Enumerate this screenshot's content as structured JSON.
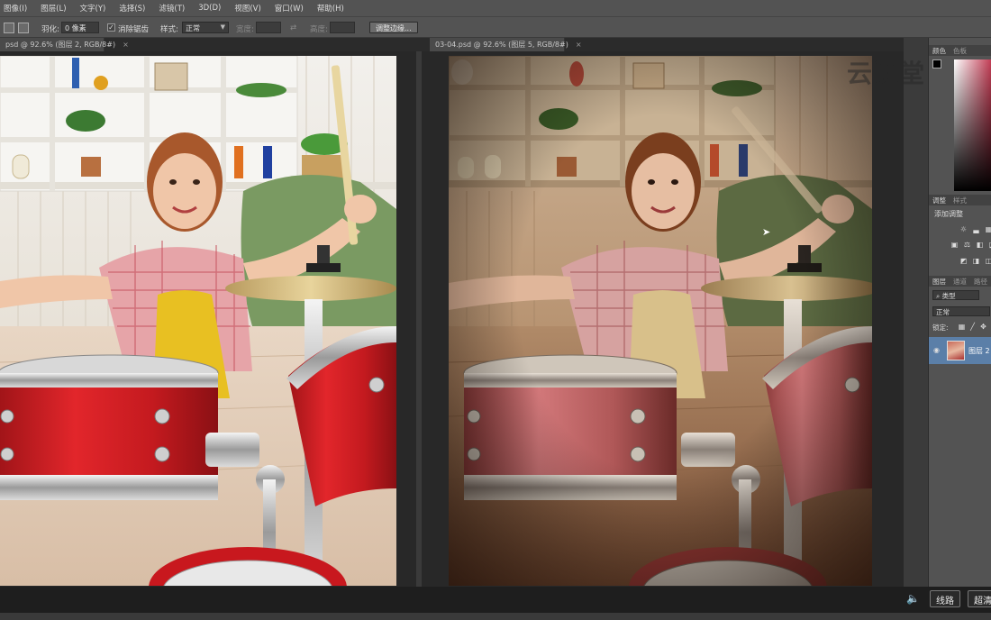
{
  "menu": [
    "图像(I)",
    "图层(L)",
    "文字(Y)",
    "选择(S)",
    "滤镜(T)",
    "3D(D)",
    "视图(V)",
    "窗口(W)",
    "帮助(H)"
  ],
  "options": {
    "feather_label": "羽化:",
    "feather_value": "0 像素",
    "antialias_label": "消除锯齿",
    "style_label": "样式:",
    "style_value": "正常",
    "width_label": "宽度:",
    "height_label": "高度:",
    "refine_button": "调整边缘..."
  },
  "tabs": {
    "left": "psd @ 92.6% (图层 2, RGB/8#)",
    "right": "03-04.psd @ 92.6% (图层 5, RGB/8#)",
    "close": "×"
  },
  "panels": {
    "color_tabs": [
      "颜色",
      "色板"
    ],
    "adjust_tabs": [
      "调整",
      "样式"
    ],
    "adjust_title": "添加调整",
    "layers_tabs": [
      "图层",
      "通道",
      "路径"
    ],
    "filter_kind": "类型",
    "blend_mode": "正常",
    "lock_label": "锁定:",
    "layer_name": "图层 2"
  },
  "watermark": "云课堂",
  "player": {
    "route_button": "线路",
    "quality_button": "超清"
  },
  "colors": {
    "ui_panel": "#535353",
    "canvas_bg": "#282828",
    "selected_layer": "#5b7fa8"
  }
}
